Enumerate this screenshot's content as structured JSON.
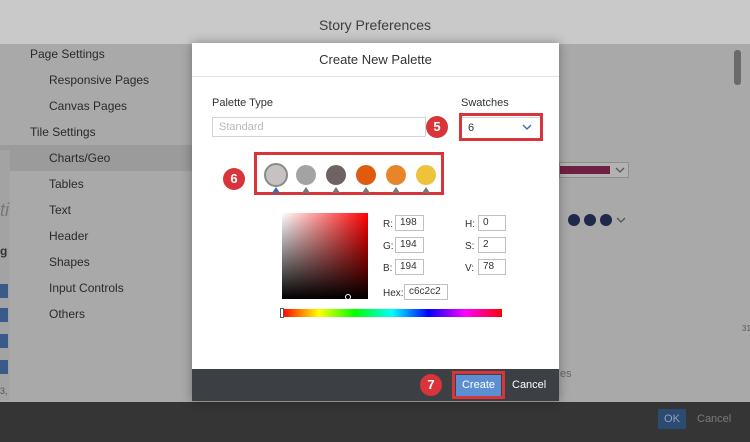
{
  "window": {
    "title": "Story Preferences"
  },
  "sidebar": {
    "items": [
      {
        "label": "Page Settings"
      },
      {
        "label": "Responsive Pages"
      },
      {
        "label": "Canvas Pages"
      },
      {
        "label": "Tile Settings"
      },
      {
        "label": "Charts/Geo"
      },
      {
        "label": "Tables"
      },
      {
        "label": "Text"
      },
      {
        "label": "Header"
      },
      {
        "label": "Shapes"
      },
      {
        "label": "Input Controls"
      },
      {
        "label": "Others"
      }
    ],
    "selected": "Charts/Geo"
  },
  "background_fragments": {
    "ti": "ti",
    "g": "g",
    "n31": "3,",
    "n29": "29",
    "es": "es",
    "n31r": "31"
  },
  "footer": {
    "ok_label": "OK",
    "cancel_label": "Cancel"
  },
  "dialog": {
    "title": "Create New Palette",
    "palette_type_label": "Palette Type",
    "palette_type_placeholder": "Standard",
    "swatches_label": "Swatches",
    "swatches_value": "6",
    "swatch_colors": [
      "#c6c2c2",
      "#a3a3a3",
      "#6e6262",
      "#e05a10",
      "#e8852a",
      "#eec23a"
    ],
    "selected_swatch": 0,
    "picker": {
      "r_label": "R:",
      "r": "198",
      "g_label": "G:",
      "g": "194",
      "b_label": "B:",
      "b": "194",
      "h_label": "H:",
      "h": "0",
      "s_label": "S:",
      "s": "2",
      "v_label": "V:",
      "v": "78",
      "hex_label": "Hex:",
      "hex": "c6c2c2"
    },
    "create_label": "Create",
    "cancel_label": "Cancel"
  },
  "annotations": {
    "step5": "5",
    "step6": "6",
    "step7": "7"
  },
  "colors": {
    "accent": "#5b8fd1",
    "callout": "#d9343a"
  }
}
